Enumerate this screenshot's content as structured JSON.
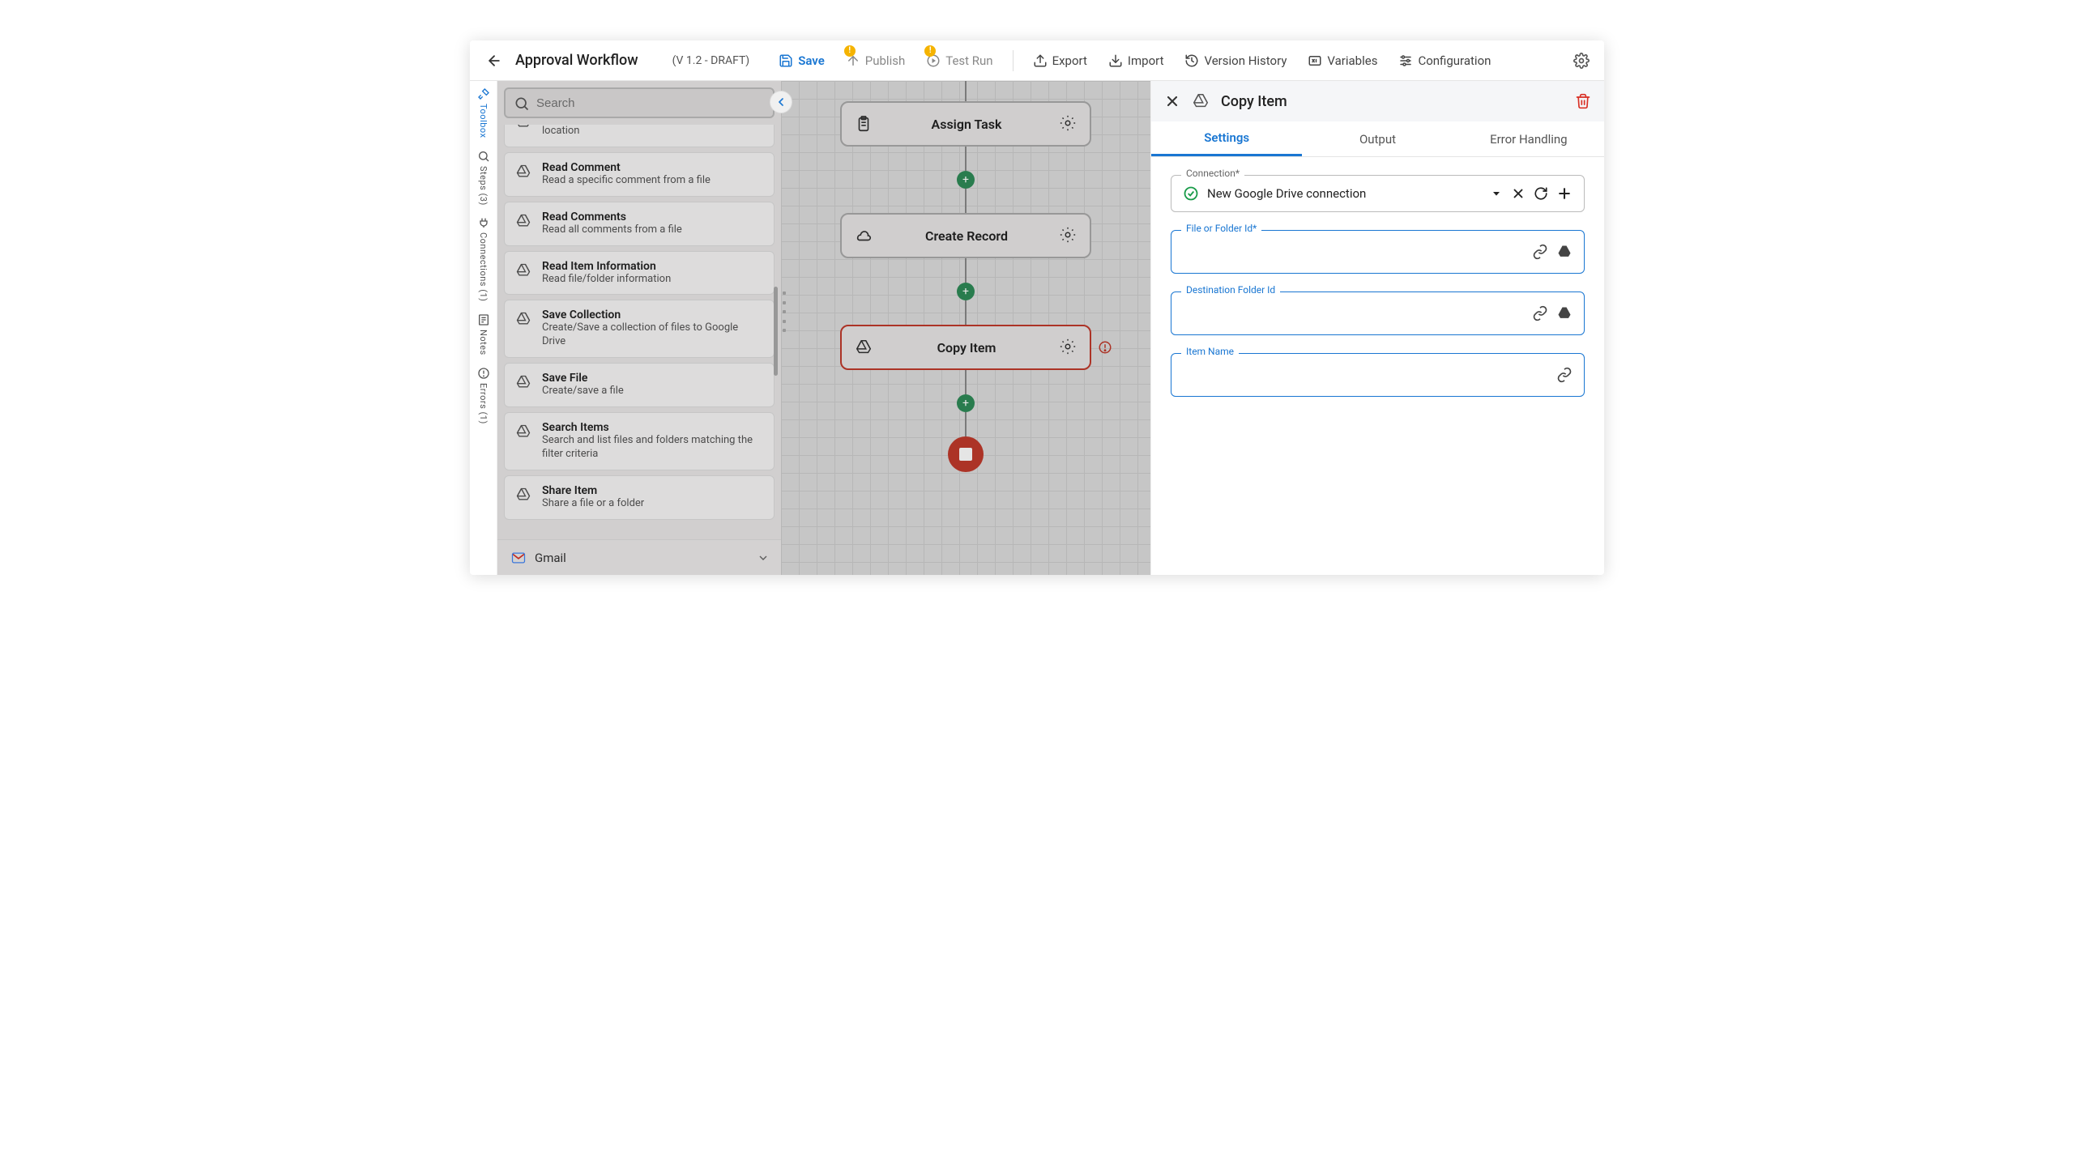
{
  "header": {
    "title": "Approval Workflow",
    "version": "(V 1.2 - DRAFT)",
    "save": "Save",
    "publish": "Publish",
    "testRun": "Test Run",
    "export": "Export",
    "import": "Import",
    "versionHistory": "Version History",
    "variables": "Variables",
    "configuration": "Configuration"
  },
  "vtabs": {
    "toolbox": "Toolbox",
    "steps": "Steps (3)",
    "connections": "Connections (1)",
    "notes": "Notes",
    "errors": "Errors (1)"
  },
  "toolbox": {
    "searchPlaceholder": "Search",
    "items": [
      {
        "name": "",
        "desc": "Move a collection of files or a folders to a new location"
      },
      {
        "name": "Read Comment",
        "desc": "Read a specific comment from a file"
      },
      {
        "name": "Read Comments",
        "desc": "Read all comments from a file"
      },
      {
        "name": "Read Item Information",
        "desc": "Read file/folder information"
      },
      {
        "name": "Save Collection",
        "desc": "Create/Save a collection of files to Google Drive"
      },
      {
        "name": "Save File",
        "desc": "Create/save a file"
      },
      {
        "name": "Search Items",
        "desc": "Search and list files and folders matching the filter criteria"
      },
      {
        "name": "Share Item",
        "desc": "Share a file or a folder"
      }
    ],
    "gmail": "Gmail"
  },
  "canvas": {
    "nodes": [
      {
        "label": "Assign Task",
        "icon": "clipboard"
      },
      {
        "label": "Create Record",
        "icon": "db"
      },
      {
        "label": "Copy Item",
        "icon": "drive"
      }
    ]
  },
  "panel": {
    "title": "Copy Item",
    "tabs": {
      "settings": "Settings",
      "output": "Output",
      "error": "Error Handling"
    },
    "fields": {
      "connection": {
        "label": "Connection*",
        "value": "New Google Drive connection"
      },
      "fileId": {
        "label": "File or Folder Id*"
      },
      "destFolder": {
        "label": "Destination Folder Id"
      },
      "itemName": {
        "label": "Item Name"
      }
    }
  }
}
